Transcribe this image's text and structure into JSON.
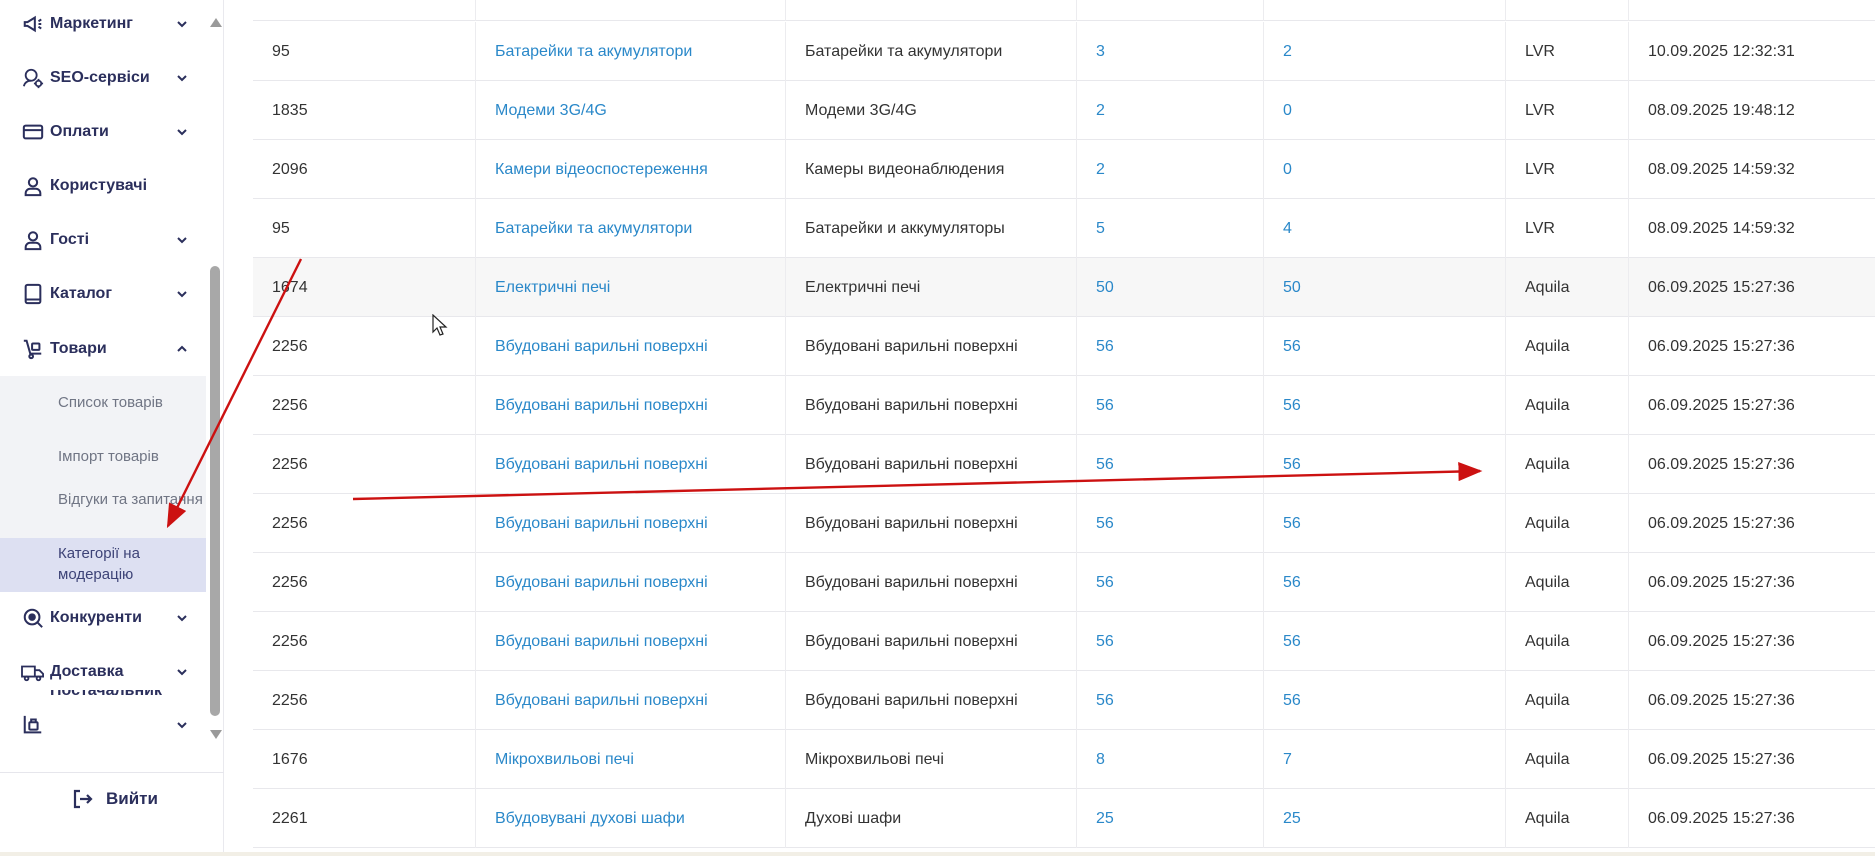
{
  "sidebar": {
    "items": [
      {
        "label": "Маркетинг",
        "icon": "megaphone-icon",
        "expanded": false
      },
      {
        "label": "SEO-сервіси",
        "icon": "seo-gear-icon",
        "expanded": false
      },
      {
        "label": "Оплати",
        "icon": "credit-card-icon",
        "expanded": false
      },
      {
        "label": "Користувачі",
        "icon": "user-icon",
        "expanded": null
      },
      {
        "label": "Гості",
        "icon": "guest-user-icon",
        "expanded": false
      },
      {
        "label": "Каталог",
        "icon": "book-icon",
        "expanded": false
      },
      {
        "label": "Товари",
        "icon": "hand-truck-icon",
        "expanded": true
      },
      {
        "label": "Конкуренти",
        "icon": "competitor-eye-icon",
        "expanded": false
      },
      {
        "label": "Доставка",
        "icon": "delivery-truck-icon",
        "expanded": false
      },
      {
        "label": "Постачальник",
        "icon": "supplier-dolly-icon",
        "expanded": false
      }
    ],
    "subitems": [
      {
        "label": "Список товарів",
        "active": false
      },
      {
        "label": "Імпорт товарів",
        "active": false
      },
      {
        "label": "Відгуки та запитання",
        "active": false
      },
      {
        "label": "Категорії на модерацію",
        "active": true
      }
    ],
    "logout_label": "Вийти"
  },
  "table": {
    "rows": [
      [
        "95",
        "Батарейки та акумулятори",
        "Батарейки та акумулятори",
        "3",
        "2",
        "LVR",
        "10.09.2025 12:32:31"
      ],
      [
        "1835",
        "Модеми 3G/4G",
        "Модеми 3G/4G",
        "2",
        "0",
        "LVR",
        "08.09.2025 19:48:12"
      ],
      [
        "2096",
        "Камери відеоспостереження",
        "Камеры видеонаблюдения",
        "2",
        "0",
        "LVR",
        "08.09.2025 14:59:32"
      ],
      [
        "95",
        "Батарейки та акумулятори",
        "Батарейки и аккумуляторы",
        "5",
        "4",
        "LVR",
        "08.09.2025 14:59:32"
      ],
      [
        "1674",
        "Електричні печі",
        "Електричні печі",
        "50",
        "50",
        "Aquila",
        "06.09.2025 15:27:36"
      ],
      [
        "2256",
        "Вбудовані варильні поверхні",
        "Вбудовані варильні поверхні",
        "56",
        "56",
        "Aquila",
        "06.09.2025 15:27:36"
      ],
      [
        "2256",
        "Вбудовані варильні поверхні",
        "Вбудовані варильні поверхні",
        "56",
        "56",
        "Aquila",
        "06.09.2025 15:27:36"
      ],
      [
        "2256",
        "Вбудовані варильні поверхні",
        "Вбудовані варильні поверхні",
        "56",
        "56",
        "Aquila",
        "06.09.2025 15:27:36"
      ],
      [
        "2256",
        "Вбудовані варильні поверхні",
        "Вбудовані варильні поверхні",
        "56",
        "56",
        "Aquila",
        "06.09.2025 15:27:36"
      ],
      [
        "2256",
        "Вбудовані варильні поверхні",
        "Вбудовані варильні поверхні",
        "56",
        "56",
        "Aquila",
        "06.09.2025 15:27:36"
      ],
      [
        "2256",
        "Вбудовані варильні поверхні",
        "Вбудовані варильні поверхні",
        "56",
        "56",
        "Aquila",
        "06.09.2025 15:27:36"
      ],
      [
        "2256",
        "Вбудовані варильні поверхні",
        "Вбудовані варильні поверхні",
        "56",
        "56",
        "Aquila",
        "06.09.2025 15:27:36"
      ],
      [
        "1676",
        "Мікрохвильові печі",
        "Мікрохвильові печі",
        "8",
        "7",
        "Aquila",
        "06.09.2025 15:27:36"
      ],
      [
        "2261",
        "Вбудовувані духові шафи",
        "Духові шафи",
        "25",
        "25",
        "Aquila",
        "06.09.2025 15:27:36"
      ]
    ],
    "link_columns": [
      1,
      3,
      4
    ],
    "highlighted_row": 4
  },
  "colors": {
    "link": "#2a88c9",
    "menu_text": "#2b2f5c",
    "submenu_bg": "#f2f3f6",
    "submenu_active_bg": "#dde0f2",
    "annotation_arrow": "#cc1111"
  }
}
